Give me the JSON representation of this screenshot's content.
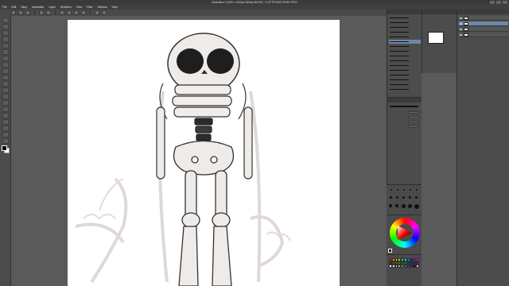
{
  "window": {
    "title": "Illustration* (1200 x 1200px 300dpi 66.6%) - CLIP STUDIO PAINT PRO"
  },
  "menubar": {
    "items": [
      "File",
      "Edit",
      "Story",
      "Animation",
      "Layer",
      "Selection",
      "View",
      "Filter",
      "Window",
      "Help"
    ]
  },
  "toolbar": {
    "tools": [
      "zoom-icon",
      "move-icon",
      "selection-icon",
      "lasso-icon",
      "eyedropper-icon",
      "pen-icon",
      "pencil-icon",
      "brush-icon",
      "airbrush-icon",
      "decoration-icon",
      "eraser-icon",
      "blend-icon",
      "fill-icon",
      "gradient-icon",
      "figure-icon",
      "frame-icon",
      "ruler-icon",
      "text-icon",
      "balloon-icon",
      "correct-line-icon"
    ],
    "main_color": "#000000",
    "sub_color": "#ffffff"
  },
  "canvas": {
    "background": "#ffffff",
    "subject": "skeleton-drawing"
  },
  "colors": {
    "panel": "#4c4c4c",
    "panel_dark": "#3a3a3a",
    "workspace": "#5a5a5a",
    "selection": "#6d87a6"
  },
  "color_set": [
    "#ff0000",
    "#ff8000",
    "#ffff00",
    "#80ff00",
    "#00ff00",
    "#00ffff",
    "#0080ff",
    "#0000ff",
    "#8000ff",
    "#ff00ff",
    "#800000",
    "#804000",
    "#808000",
    "#408000",
    "#008000",
    "#008080",
    "#004080",
    "#000080",
    "#400080",
    "#800080",
    "#ffffff",
    "#e0e0e0",
    "#c0c0c0",
    "#a0a0a0",
    "#808080",
    "#606060",
    "#404040",
    "#202020",
    "#000000",
    "#ffc0c0"
  ]
}
